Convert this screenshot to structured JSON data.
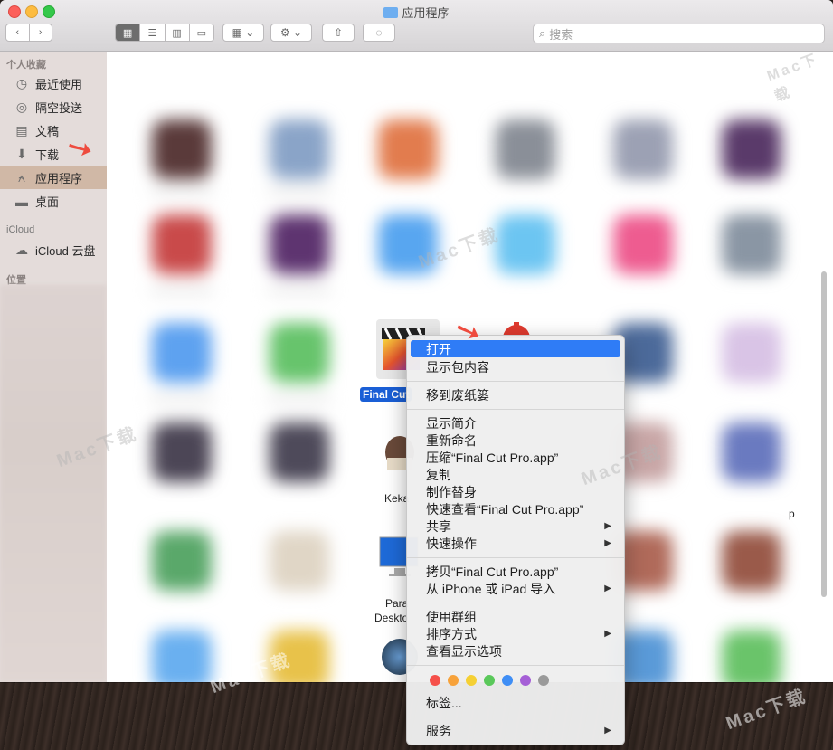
{
  "window": {
    "title": "应用程序"
  },
  "toolbar": {
    "search_placeholder": "搜索"
  },
  "sidebar": {
    "favorites_header": "个人收藏",
    "favorites": [
      {
        "label": "最近使用",
        "icon": "clock-icon"
      },
      {
        "label": "隔空投送",
        "icon": "airdrop-icon"
      },
      {
        "label": "文稿",
        "icon": "document-icon"
      },
      {
        "label": "下载",
        "icon": "download-icon"
      },
      {
        "label": "应用程序",
        "icon": "applications-icon",
        "selected": true
      },
      {
        "label": "桌面",
        "icon": "desktop-icon"
      }
    ],
    "icloud_header": "iCloud",
    "icloud_items": [
      {
        "label": "iCloud 云盘",
        "icon": "cloud-icon"
      }
    ],
    "locations_header": "位置"
  },
  "content": {
    "selected_item": "Final Cut",
    "visible_labels": [
      "Keka",
      "Para",
      "Deskto",
      "p"
    ]
  },
  "context_menu": {
    "items": [
      {
        "label": "打开",
        "highlighted": true
      },
      {
        "label": "显示包内容"
      },
      {
        "label": "移到废纸篓"
      },
      {
        "label": "显示简介"
      },
      {
        "label": "重新命名"
      },
      {
        "label": "压缩“Final Cut Pro.app”"
      },
      {
        "label": "复制"
      },
      {
        "label": "制作替身"
      },
      {
        "label": "快速查看“Final Cut Pro.app”"
      },
      {
        "label": "共享",
        "submenu": true
      },
      {
        "label": "快速操作",
        "submenu": true
      },
      {
        "label": "拷贝“Final Cut Pro.app”"
      },
      {
        "label": "从 iPhone 或 iPad 导入",
        "submenu": true
      },
      {
        "label": "使用群组"
      },
      {
        "label": "排序方式",
        "submenu": true
      },
      {
        "label": "查看显示选项"
      },
      {
        "label": "标签..."
      },
      {
        "label": "服务",
        "submenu": true
      }
    ],
    "tag_colors": [
      "#f5504a",
      "#f7a23a",
      "#f5d034",
      "#5ac85a",
      "#3f8ef5",
      "#a55fd6",
      "#9a9a9a"
    ]
  },
  "watermark": "Mac下载"
}
